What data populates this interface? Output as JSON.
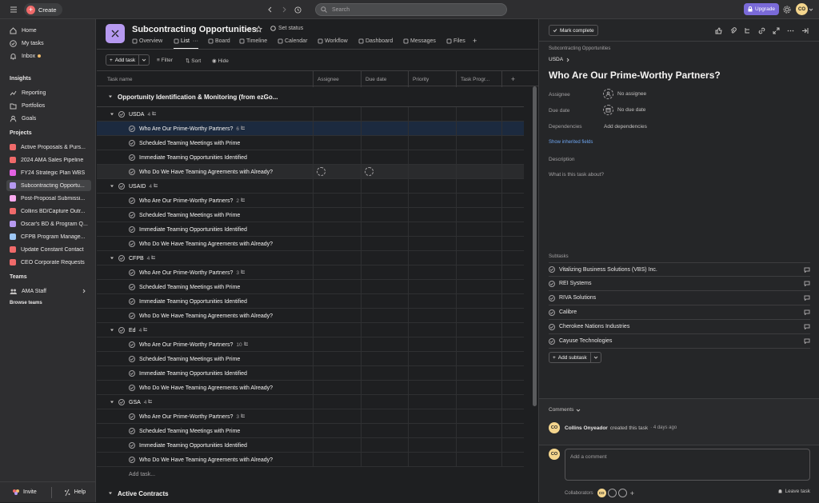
{
  "topbar": {
    "create_label": "Create",
    "search_placeholder": "Search",
    "upgrade_label": "Upgrade",
    "user_initials": "CO"
  },
  "sidebar": {
    "nav": [
      {
        "label": "Home",
        "icon": "home-icon"
      },
      {
        "label": "My tasks",
        "icon": "check-circle-icon"
      },
      {
        "label": "Inbox",
        "icon": "bell-icon",
        "dot": true
      }
    ],
    "insights_heading": "Insights",
    "insights": [
      {
        "label": "Reporting",
        "icon": "chart-line-icon"
      },
      {
        "label": "Portfolios",
        "icon": "folder-icon"
      },
      {
        "label": "Goals",
        "icon": "person-icon"
      }
    ],
    "projects_heading": "Projects",
    "projects": [
      {
        "label": "Active Proposals & Purs...",
        "color": "#f06a6a"
      },
      {
        "label": "2024 AMA Sales Pipeline",
        "color": "#f06a6a"
      },
      {
        "label": "FY24 Strategic Plan WBS",
        "color": "#e362e3"
      },
      {
        "label": "Subcontracting Opportu...",
        "color": "#b699f0",
        "active": true
      },
      {
        "label": "Post-Proposal Submissi...",
        "color": "#f9aaef"
      },
      {
        "label": "Collins BD/Capture Outr...",
        "color": "#f06a6a"
      },
      {
        "label": "Oscar's BD & Program Q...",
        "color": "#b699f0"
      },
      {
        "label": "CFPB Program Manage...",
        "color": "#9ec7f5"
      },
      {
        "label": "Update Constant Contact",
        "color": "#f06a6a"
      },
      {
        "label": "CEO Corporate Requests",
        "color": "#f06a6a"
      }
    ],
    "teams_heading": "Teams",
    "team": "AMA Staff",
    "browse_teams": "Browse teams",
    "invite_label": "Invite",
    "help_label": "Help"
  },
  "project": {
    "title": "Subcontracting Opportunities",
    "set_status": "Set status",
    "tabs": [
      {
        "label": "Overview"
      },
      {
        "label": "List",
        "active": true
      },
      {
        "label": "Board"
      },
      {
        "label": "Timeline"
      },
      {
        "label": "Calendar"
      },
      {
        "label": "Workflow"
      },
      {
        "label": "Dashboard"
      },
      {
        "label": "Messages"
      },
      {
        "label": "Files"
      }
    ],
    "toolbar": {
      "add_task": "Add task",
      "filter": "Filter",
      "sort": "Sort",
      "hide": "Hide"
    },
    "columns": [
      "Task name",
      "Assignee",
      "Due date",
      "Priority",
      "Task Progr..."
    ],
    "section_title": "Opportunity Identification & Monitoring (from ezGo...",
    "next_section": "Active Contracts",
    "add_task_row": "Add task...",
    "groups": [
      {
        "name": "USDA",
        "count": "4",
        "tasks": [
          {
            "name": "Who Are Our Prime-Worthy Partners?",
            "subtasks": "6",
            "selected": true
          },
          {
            "name": "Scheduled Teaming Meetings with Prime"
          },
          {
            "name": "Immediate Teaming Opportunities Identified"
          },
          {
            "name": "Who Do We Have Teaming Agreements with Already?",
            "hover": true
          }
        ]
      },
      {
        "name": "USAID",
        "count": "4",
        "tasks": [
          {
            "name": "Who Are Our Prime-Worthy Partners?",
            "subtasks": "2"
          },
          {
            "name": "Scheduled Teaming Meetings with Prime"
          },
          {
            "name": "Immediate Teaming Opportunities Identified"
          },
          {
            "name": "Who Do We Have Teaming Agreements with Already?"
          }
        ]
      },
      {
        "name": "CFPB",
        "count": "4",
        "tasks": [
          {
            "name": "Who Are Our Prime-Worthy Partners?",
            "subtasks": "3"
          },
          {
            "name": "Scheduled Teaming Meetings with Prime"
          },
          {
            "name": "Immediate Teaming Opportunities Identified"
          },
          {
            "name": "Who Do We Have Teaming Agreements with Already?"
          }
        ]
      },
      {
        "name": "Ed",
        "count": "4",
        "tasks": [
          {
            "name": "Who Are Our Prime-Worthy Partners?",
            "subtasks": "10"
          },
          {
            "name": "Scheduled Teaming Meetings with Prime"
          },
          {
            "name": "Immediate Teaming Opportunities Identified"
          },
          {
            "name": "Who Do We Have Teaming Agreements with Already?"
          }
        ]
      },
      {
        "name": "GSA",
        "count": "4",
        "tasks": [
          {
            "name": "Who Are Our Prime-Worthy Partners?",
            "subtasks": "3"
          },
          {
            "name": "Scheduled Teaming Meetings with Prime"
          },
          {
            "name": "Immediate Teaming Opportunities Identified"
          },
          {
            "name": "Who Do We Have Teaming Agreements with Already?"
          }
        ]
      }
    ]
  },
  "detail": {
    "mark_complete": "Mark complete",
    "project_link": "Subcontracting Opportunities",
    "parent": "USDA",
    "title": "Who Are Our Prime-Worthy Partners?",
    "assignee_label": "Assignee",
    "assignee_value": "No assignee",
    "due_label": "Due date",
    "due_value": "No due date",
    "dependencies_label": "Dependencies",
    "dependencies_value": "Add dependencies",
    "inherited": "Show inherited fields",
    "description_label": "Description",
    "description_placeholder": "What is this task about?",
    "subtasks_label": "Subtasks",
    "subtasks": [
      "Vitalizing Business Solutions (VBS) Inc.",
      "REI Systems",
      "RIVA Solutions",
      "Calibre",
      "Cherokee Nations Industries",
      "Cayuse Technologies"
    ],
    "add_subtask": "Add subtask",
    "comments_label": "Comments",
    "activity_user": "Collins Onyeador",
    "activity_text": "created this task",
    "activity_time": "· 4 days ago",
    "comment_placeholder": "Add a comment",
    "collaborators_label": "Collaborators",
    "leave_task": "Leave task",
    "user_initials": "CO"
  },
  "colors": {
    "accent_purple": "#b699f0",
    "upgrade": "#7a6ad8",
    "create": "#f06a6a",
    "selected_row": "#1c2a3f"
  }
}
